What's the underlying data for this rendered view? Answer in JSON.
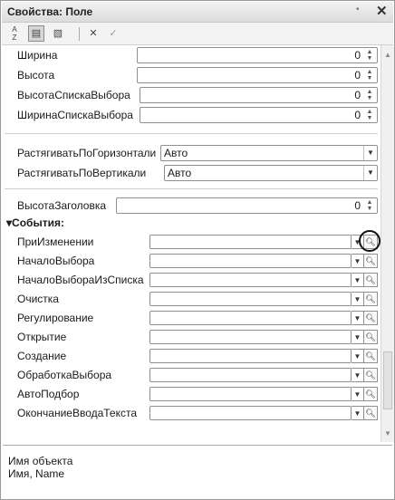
{
  "window": {
    "title": "Свойства: Поле",
    "pin_glyph": "•",
    "close_glyph": "✕"
  },
  "toolbar": {
    "sort_icon": "A↓Z",
    "categories_icon": "▤",
    "filter_icon": "▧",
    "clear_glyph": "✕",
    "apply_glyph": "✓"
  },
  "properties": {
    "width": {
      "label": "Ширина",
      "value": "0"
    },
    "height": {
      "label": "Высота",
      "value": "0"
    },
    "list_height": {
      "label": "ВысотаСпискаВыбора",
      "value": "0"
    },
    "list_width": {
      "label": "ШиринаСпискаВыбора",
      "value": "0"
    },
    "stretch_h": {
      "label": "РастягиватьПоГоризонтали",
      "value": "Авто"
    },
    "stretch_v": {
      "label": "РастягиватьПоВертикали",
      "value": "Авто"
    },
    "header_height": {
      "label": "ВысотаЗаголовка",
      "value": "0"
    }
  },
  "events_section": {
    "label": "События:",
    "toggle": "▾"
  },
  "events": [
    {
      "label": "ПриИзменении",
      "value": ""
    },
    {
      "label": "НачалоВыбора",
      "value": ""
    },
    {
      "label": "НачалоВыбораИзСписка",
      "value": ""
    },
    {
      "label": "Очистка",
      "value": ""
    },
    {
      "label": "Регулирование",
      "value": ""
    },
    {
      "label": "Открытие",
      "value": ""
    },
    {
      "label": "Создание",
      "value": ""
    },
    {
      "label": "ОбработкаВыбора",
      "value": ""
    },
    {
      "label": "АвтоПодбор",
      "value": ""
    },
    {
      "label": "ОкончаниеВводаТекста",
      "value": ""
    }
  ],
  "glyphs": {
    "spin": "▴\n▾",
    "dropdown": "▼",
    "search": "⚲"
  },
  "description": {
    "line1": "Имя объекта",
    "line2": "Имя, Name"
  }
}
